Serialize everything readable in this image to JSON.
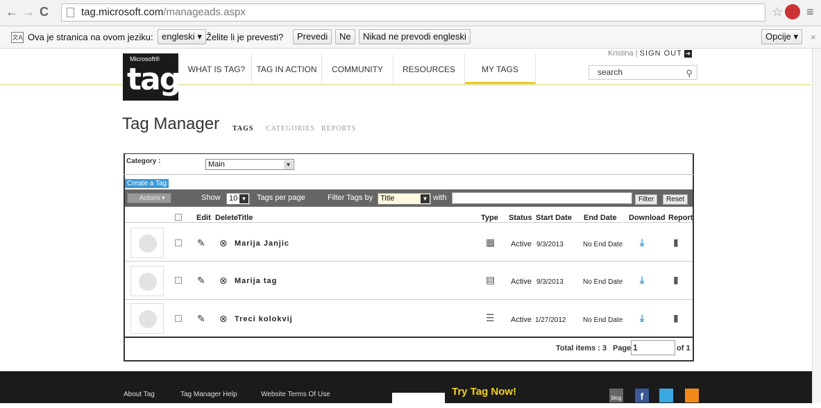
{
  "browser": {
    "url_host": "tag.microsoft.com",
    "url_path": "/manageads.aspx",
    "translate_prompt": "Ova je stranica na ovom jeziku:",
    "language": "engleski",
    "translate_question": "Želite li je prevesti?",
    "translate_btn": "Prevedi",
    "no_btn": "Ne",
    "never_btn": "Nikad ne prevodi engleski",
    "options_btn": "Opcije"
  },
  "site": {
    "logo_small": "Microsoft®",
    "logo_big": "tag",
    "nav": [
      "WHAT IS TAG?",
      "TAG IN ACTION",
      "COMMUNITY",
      "RESOURCES",
      "MY TAGS"
    ],
    "user": "Kristina",
    "sign_out": "SIGN OUT",
    "search_placeholder": "search"
  },
  "manager": {
    "title": "Tag Manager",
    "tabs": [
      "TAGS",
      "CATEGORIES",
      "REPORTS"
    ],
    "category_label": "Category :",
    "category_value": "Main",
    "create_btn": "Create a Tag",
    "actions": "Actions",
    "show": "Show",
    "per_page_value": "10",
    "per_page_label": "Tags per page",
    "filter_by": "Filter Tags by",
    "filter_field": "Title",
    "with": "with",
    "filter_btn": "Filter",
    "reset_btn": "Reset",
    "columns": [
      "Edit",
      "Delete",
      "Title",
      "Type",
      "Status",
      "Start Date",
      "End Date",
      "Download",
      "Report"
    ],
    "rows": [
      {
        "title": "Marija Janjic",
        "status": "Active",
        "start": "9/3/2013",
        "end": "No End Date"
      },
      {
        "title": "Marija tag",
        "status": "Active",
        "start": "9/3/2013",
        "end": "No End Date"
      },
      {
        "title": "Treci kolokvij",
        "status": "Active",
        "start": "1/27/2012",
        "end": "No End Date"
      }
    ],
    "total_label": "Total items : 3",
    "page_label": "Page",
    "page_value": "1",
    "of_label": "of 1"
  },
  "footer": {
    "links": [
      "About Tag",
      "Tag Manager Help",
      "Website Terms Of Use"
    ],
    "promo": "Try Tag Now!",
    "blog": "blog"
  }
}
